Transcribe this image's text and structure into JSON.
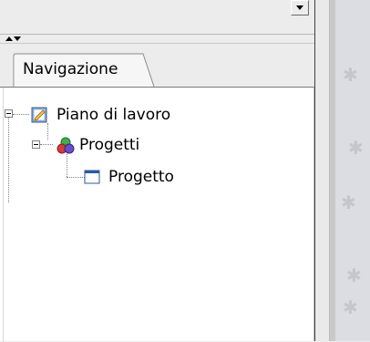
{
  "navigation_panel": {
    "tab_label": "Navigazione",
    "tree": [
      {
        "label": "Piano di lavoro",
        "icon": "workspace-icon",
        "expanded": true
      },
      {
        "label": "Progetti",
        "icon": "projects-icon",
        "expanded": true
      },
      {
        "label": "Progetto",
        "icon": "project-window-icon"
      }
    ]
  },
  "colors": {
    "panel_background": "#ffffff",
    "chrome_background": "#ececec",
    "right_background": "#dcdde2"
  }
}
